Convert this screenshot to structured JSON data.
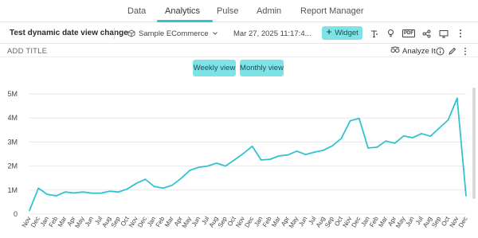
{
  "nav": {
    "tabs": [
      {
        "label": "Data"
      },
      {
        "label": "Analytics"
      },
      {
        "label": "Pulse"
      },
      {
        "label": "Admin"
      },
      {
        "label": "Report Manager"
      }
    ],
    "active_tab": "Analytics",
    "accent_color": "#32c3cf"
  },
  "toolbar": {
    "dashboard_title": "Test dynamic date view change",
    "data_source": "Sample ECommerce",
    "timestamp": "Mar 27, 2025 11:17:4...",
    "widget_button": "Widget",
    "tool_icons": [
      "text-icon",
      "bulb-icon",
      "pdf-icon",
      "share-icon",
      "present-icon",
      "more-vertical-icon"
    ]
  },
  "widget": {
    "title_placeholder": "ADD TITLE",
    "analyze_label": "Analyze It",
    "toggle": {
      "weekly_label": "Weekly view",
      "monthly_label": "Monthly view",
      "button_color": "#7ee3e6"
    }
  },
  "chart_data": {
    "type": "line",
    "title": "",
    "xlabel": "",
    "ylabel": "",
    "grid": true,
    "line_color": "#32c3cf",
    "ylim": [
      0,
      5000000
    ],
    "y_ticks": [
      0,
      1000000,
      2000000,
      3000000,
      4000000,
      5000000
    ],
    "y_tick_labels": [
      "0",
      "1M",
      "2M",
      "3M",
      "4M",
      "5M"
    ],
    "categories": [
      "Nov",
      "Dec",
      "Jan",
      "Feb",
      "Mar",
      "Apr",
      "May",
      "Jun",
      "Jul",
      "Aug",
      "Sep",
      "Oct",
      "Nov",
      "Dec",
      "Jan",
      "Feb",
      "Mar",
      "Apr",
      "May",
      "Jun",
      "Jul",
      "Aug",
      "Sep",
      "Oct",
      "Nov",
      "Dec",
      "Jan",
      "Feb",
      "Mar",
      "Apr",
      "May",
      "Jun",
      "Jul",
      "Aug",
      "Sep",
      "Oct",
      "Nov",
      "Dec",
      "Jan",
      "Feb",
      "Mar",
      "Apr",
      "May",
      "Jun",
      "Jul",
      "Aug",
      "Sep",
      "Oct",
      "Nov",
      "Dec"
    ],
    "series": [
      {
        "values": [
          150000,
          1080000,
          820000,
          760000,
          920000,
          880000,
          920000,
          870000,
          870000,
          950000,
          920000,
          1050000,
          1280000,
          1450000,
          1150000,
          1080000,
          1200000,
          1480000,
          1820000,
          1950000,
          2000000,
          2120000,
          2000000,
          2250000,
          2520000,
          2820000,
          2250000,
          2280000,
          2420000,
          2460000,
          2620000,
          2480000,
          2580000,
          2660000,
          2840000,
          3150000,
          3880000,
          3980000,
          2750000,
          2780000,
          3040000,
          2950000,
          3250000,
          3180000,
          3350000,
          3240000,
          3580000,
          3920000,
          4820000,
          760000
        ]
      }
    ]
  }
}
